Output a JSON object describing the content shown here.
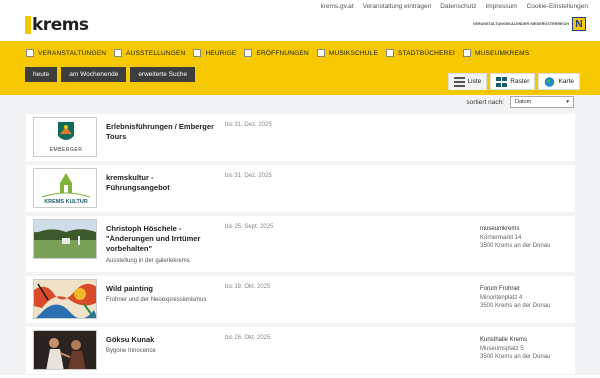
{
  "header": {
    "logo_text": "krems",
    "links": [
      "krems.gv.at",
      "Veranstaltung eintragen",
      "Datenschutz",
      "Impressum",
      "Cookie-Einstellungen"
    ],
    "sponsor_text": "VERANSTALTUNGSKALENDER NIEDERÖSTERREICH",
    "sponsor_mark": "N"
  },
  "filters": {
    "categories": [
      "VERANSTALTUNGEN",
      "AUSSTELLUNGEN",
      "HEURIGE",
      "ERÖFFNUNGEN",
      "MUSIKSCHULE",
      "STADTBÜCHEREI",
      "MUSEUMKREMS"
    ],
    "buttons": [
      "heute",
      "am Wochenende",
      "erweiterte Suche"
    ]
  },
  "views": {
    "tabs": [
      {
        "label": "Liste",
        "icon": "list-icon"
      },
      {
        "label": "Raster",
        "icon": "grid-icon"
      },
      {
        "label": "Karte",
        "icon": "globe-icon"
      }
    ],
    "active": "Liste"
  },
  "sort": {
    "label": "sortiert nach:",
    "value": "Datum"
  },
  "events": [
    {
      "title": "Erlebnisführungen / Emberger Tours",
      "subtitle": "",
      "date": "bis 31. Dez. 2025",
      "location": "",
      "street": "",
      "city": "",
      "thumb_text": "EMBERGER"
    },
    {
      "title": "kremskultur - Führungsangebot",
      "subtitle": "",
      "date": "bis 31. Dez. 2025",
      "location": "",
      "street": "",
      "city": "",
      "thumb_text": "KREMS KULTUR"
    },
    {
      "title": "Christoph Höschele - \"Änderungen und Irrtümer vorbehalten\"",
      "subtitle": "Ausstellung in der galeriekrems",
      "date": "bis 25. Sept. 2025",
      "location": "museumkrems",
      "street": "Körnermarkt 14",
      "city": "3500 Krems an der Donau",
      "thumb_text": ""
    },
    {
      "title": "Wild painting",
      "subtitle": "Frohner und der Neoexpressionismus",
      "date": "bis 19. Okt. 2025",
      "location": "Forum Frohner",
      "street": "Minoritenplatz 4",
      "city": "3500 Krems an der Donau",
      "thumb_text": ""
    },
    {
      "title": "Göksu Kunak",
      "subtitle": "Bygone Innocence",
      "date": "bis 26. Okt. 2025",
      "location": "Kunsthalle Krems",
      "street": "Museumsplatz 5",
      "city": "3500 Krems an der Donau",
      "thumb_text": ""
    }
  ]
}
